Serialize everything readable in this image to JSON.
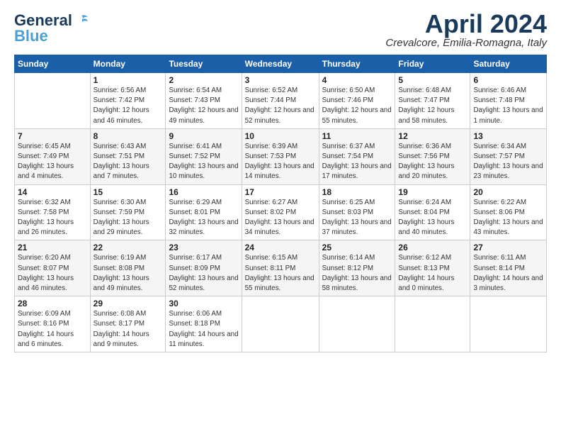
{
  "logo": {
    "general": "General",
    "blue": "Blue"
  },
  "title": "April 2024",
  "location": "Crevalcore, Emilia-Romagna, Italy",
  "weekdays": [
    "Sunday",
    "Monday",
    "Tuesday",
    "Wednesday",
    "Thursday",
    "Friday",
    "Saturday"
  ],
  "weeks": [
    [
      {
        "day": "",
        "info": ""
      },
      {
        "day": "1",
        "info": "Sunrise: 6:56 AM\nSunset: 7:42 PM\nDaylight: 12 hours\nand 46 minutes."
      },
      {
        "day": "2",
        "info": "Sunrise: 6:54 AM\nSunset: 7:43 PM\nDaylight: 12 hours\nand 49 minutes."
      },
      {
        "day": "3",
        "info": "Sunrise: 6:52 AM\nSunset: 7:44 PM\nDaylight: 12 hours\nand 52 minutes."
      },
      {
        "day": "4",
        "info": "Sunrise: 6:50 AM\nSunset: 7:46 PM\nDaylight: 12 hours\nand 55 minutes."
      },
      {
        "day": "5",
        "info": "Sunrise: 6:48 AM\nSunset: 7:47 PM\nDaylight: 12 hours\nand 58 minutes."
      },
      {
        "day": "6",
        "info": "Sunrise: 6:46 AM\nSunset: 7:48 PM\nDaylight: 13 hours\nand 1 minute."
      }
    ],
    [
      {
        "day": "7",
        "info": "Sunrise: 6:45 AM\nSunset: 7:49 PM\nDaylight: 13 hours\nand 4 minutes."
      },
      {
        "day": "8",
        "info": "Sunrise: 6:43 AM\nSunset: 7:51 PM\nDaylight: 13 hours\nand 7 minutes."
      },
      {
        "day": "9",
        "info": "Sunrise: 6:41 AM\nSunset: 7:52 PM\nDaylight: 13 hours\nand 10 minutes."
      },
      {
        "day": "10",
        "info": "Sunrise: 6:39 AM\nSunset: 7:53 PM\nDaylight: 13 hours\nand 14 minutes."
      },
      {
        "day": "11",
        "info": "Sunrise: 6:37 AM\nSunset: 7:54 PM\nDaylight: 13 hours\nand 17 minutes."
      },
      {
        "day": "12",
        "info": "Sunrise: 6:36 AM\nSunset: 7:56 PM\nDaylight: 13 hours\nand 20 minutes."
      },
      {
        "day": "13",
        "info": "Sunrise: 6:34 AM\nSunset: 7:57 PM\nDaylight: 13 hours\nand 23 minutes."
      }
    ],
    [
      {
        "day": "14",
        "info": "Sunrise: 6:32 AM\nSunset: 7:58 PM\nDaylight: 13 hours\nand 26 minutes."
      },
      {
        "day": "15",
        "info": "Sunrise: 6:30 AM\nSunset: 7:59 PM\nDaylight: 13 hours\nand 29 minutes."
      },
      {
        "day": "16",
        "info": "Sunrise: 6:29 AM\nSunset: 8:01 PM\nDaylight: 13 hours\nand 32 minutes."
      },
      {
        "day": "17",
        "info": "Sunrise: 6:27 AM\nSunset: 8:02 PM\nDaylight: 13 hours\nand 34 minutes."
      },
      {
        "day": "18",
        "info": "Sunrise: 6:25 AM\nSunset: 8:03 PM\nDaylight: 13 hours\nand 37 minutes."
      },
      {
        "day": "19",
        "info": "Sunrise: 6:24 AM\nSunset: 8:04 PM\nDaylight: 13 hours\nand 40 minutes."
      },
      {
        "day": "20",
        "info": "Sunrise: 6:22 AM\nSunset: 8:06 PM\nDaylight: 13 hours\nand 43 minutes."
      }
    ],
    [
      {
        "day": "21",
        "info": "Sunrise: 6:20 AM\nSunset: 8:07 PM\nDaylight: 13 hours\nand 46 minutes."
      },
      {
        "day": "22",
        "info": "Sunrise: 6:19 AM\nSunset: 8:08 PM\nDaylight: 13 hours\nand 49 minutes."
      },
      {
        "day": "23",
        "info": "Sunrise: 6:17 AM\nSunset: 8:09 PM\nDaylight: 13 hours\nand 52 minutes."
      },
      {
        "day": "24",
        "info": "Sunrise: 6:15 AM\nSunset: 8:11 PM\nDaylight: 13 hours\nand 55 minutes."
      },
      {
        "day": "25",
        "info": "Sunrise: 6:14 AM\nSunset: 8:12 PM\nDaylight: 13 hours\nand 58 minutes."
      },
      {
        "day": "26",
        "info": "Sunrise: 6:12 AM\nSunset: 8:13 PM\nDaylight: 14 hours\nand 0 minutes."
      },
      {
        "day": "27",
        "info": "Sunrise: 6:11 AM\nSunset: 8:14 PM\nDaylight: 14 hours\nand 3 minutes."
      }
    ],
    [
      {
        "day": "28",
        "info": "Sunrise: 6:09 AM\nSunset: 8:16 PM\nDaylight: 14 hours\nand 6 minutes."
      },
      {
        "day": "29",
        "info": "Sunrise: 6:08 AM\nSunset: 8:17 PM\nDaylight: 14 hours\nand 9 minutes."
      },
      {
        "day": "30",
        "info": "Sunrise: 6:06 AM\nSunset: 8:18 PM\nDaylight: 14 hours\nand 11 minutes."
      },
      {
        "day": "",
        "info": ""
      },
      {
        "day": "",
        "info": ""
      },
      {
        "day": "",
        "info": ""
      },
      {
        "day": "",
        "info": ""
      }
    ]
  ]
}
